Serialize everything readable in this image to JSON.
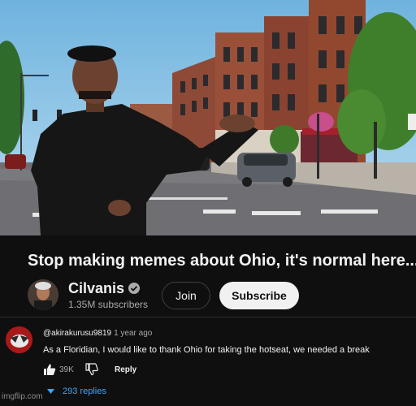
{
  "video": {
    "scene": "street-scene"
  },
  "title": "Stop making memes about Ohio, it's normal here...",
  "channel": {
    "name": "Cilvanis",
    "subscribers": "1.35M subscribers",
    "join_label": "Join",
    "subscribe_label": "Subscribe"
  },
  "comment": {
    "handle": "@akirakurusu9819",
    "time": "1 year ago",
    "text": "As a Floridian, I would like to thank Ohio for taking the hotseat, we needed a break",
    "likes": "39K",
    "reply_label": "Reply",
    "replies_label": "293 replies"
  },
  "watermark": "imgflip.com",
  "colors": {
    "background": "#0f0f0f",
    "link": "#3ea6ff",
    "subscribe_bg": "#f1f1f1"
  }
}
